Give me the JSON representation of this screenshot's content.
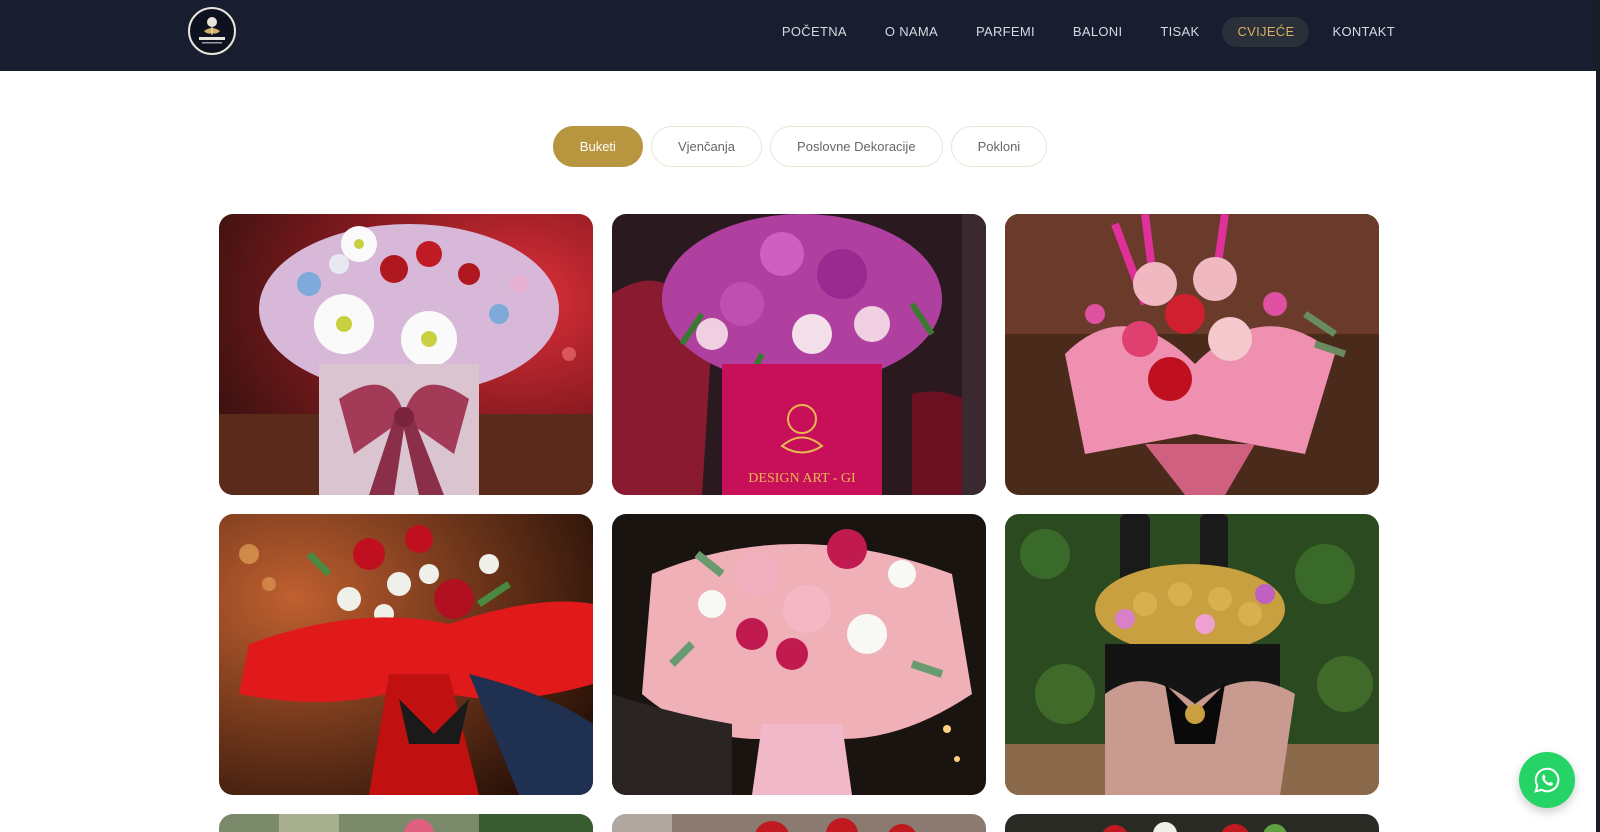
{
  "brand": {
    "logo_text": "DESIGN ART - GI",
    "colors": {
      "header_bg": "#181e30",
      "accent_gold": "#b8963f",
      "nav_active_text": "#d4b063",
      "whatsapp_green": "#25d366"
    }
  },
  "nav": {
    "items": [
      {
        "label": "POČETNA"
      },
      {
        "label": "O NAMA"
      },
      {
        "label": "PARFEMI"
      },
      {
        "label": "BALONI"
      },
      {
        "label": "TISAK"
      },
      {
        "label": "CVIJEĆE"
      },
      {
        "label": "KONTAKT"
      }
    ],
    "active": "CVIJEĆE"
  },
  "filters": {
    "items": [
      {
        "label": "Buketi"
      },
      {
        "label": "Vjenčanja"
      },
      {
        "label": "Poslovne Dekoracije"
      },
      {
        "label": "Pokloni"
      }
    ],
    "active": "Buketi"
  },
  "gallery": {
    "photos": [
      {
        "icon": "flower-bouquet-photo"
      },
      {
        "icon": "flower-box-photo",
        "box_text": "DESIGN ART - GI"
      },
      {
        "icon": "pink-bouquet-photo"
      },
      {
        "icon": "red-bouquet-photo"
      },
      {
        "icon": "pink-roses-photo"
      },
      {
        "icon": "chocolate-gift-box-photo"
      },
      {
        "icon": "partial-photo"
      },
      {
        "icon": "partial-photo"
      },
      {
        "icon": "partial-photo"
      }
    ]
  },
  "whatsapp": {
    "icon": "whatsapp-icon"
  }
}
